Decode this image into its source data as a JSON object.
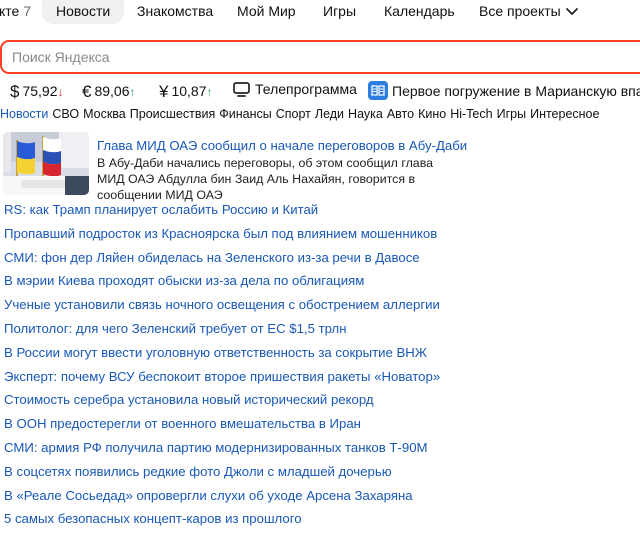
{
  "top_nav": {
    "partial_item": {
      "label": "кте",
      "count": "7"
    },
    "items": [
      "Новости",
      "Знакомства",
      "Мой Мир",
      "Игры",
      "Календарь",
      "Все проекты"
    ],
    "active": "Новости"
  },
  "search": {
    "placeholder": "Поиск Яндекса",
    "value": ""
  },
  "informers": {
    "usd": {
      "symbol": "$",
      "value": "75,92",
      "trend": "↓"
    },
    "eur": {
      "symbol": "€",
      "value": "89,06",
      "trend": "↑"
    },
    "cny": {
      "symbol": "¥",
      "value": "10,87",
      "trend": "↑"
    },
    "tv_label": "Телепрограмма",
    "promo_label": "Первое погружение в Марианскую впад"
  },
  "tabs": [
    "Новости",
    "СВО",
    "Москва",
    "Происшествия",
    "Финансы",
    "Спорт",
    "Леди",
    "Наука",
    "Авто",
    "Кино",
    "Hi-Tech",
    "Игры",
    "Интересное"
  ],
  "lead": {
    "title": "Глава МИД ОАЭ сообщил о начале переговоров в Абу-Даби",
    "description": "В Абу-Даби начались переговоры, об этом сообщил глава МИД ОАЭ Абдулла бин Заид Аль Нахайян, говорится в сообщении МИД ОАЭ"
  },
  "news": [
    "RS: как Трамп планирует ослабить Россию и Китай",
    "Пропавший подросток из Красноярска был под влиянием мошенников",
    "СМИ: фон дер Ляйен обиделась на Зеленского из-за речи в Давосе",
    "В мэрии Киева проходят обыски из-за дела по облигациям",
    "Ученые установили связь ночного освещения с обострением аллергии",
    "Политолог: для чего Зеленский требует от ЕС $1,5 трлн",
    "В России могут ввести уголовную ответственность за сокрытие ВНЖ",
    "Эксперт: почему ВСУ беспокоит второе пришествия ракеты «Новатор»",
    "Стоимость серебра установила новый исторический рекорд",
    "В ООН предостерегли от военного вмешательства в Иран",
    "СМИ: армия РФ получила партию модернизированных танков Т-90М",
    "В соцсетях появились редкие фото Джоли с младшей дочерью",
    "В «Реале Сосьедад» опровергли слухи об уходе Арсена Захаряна",
    "5 самых безопасных концепт-каров из прошлого"
  ],
  "colors": {
    "link": "#1858b8",
    "search_border": "#fc3f1d",
    "rate_down": "#e0243b",
    "rate_up": "#1fa65a",
    "active_tab_bg": "#f0f0f3"
  },
  "icons": [
    "chevron-down-icon",
    "tv-icon",
    "book-icon"
  ]
}
